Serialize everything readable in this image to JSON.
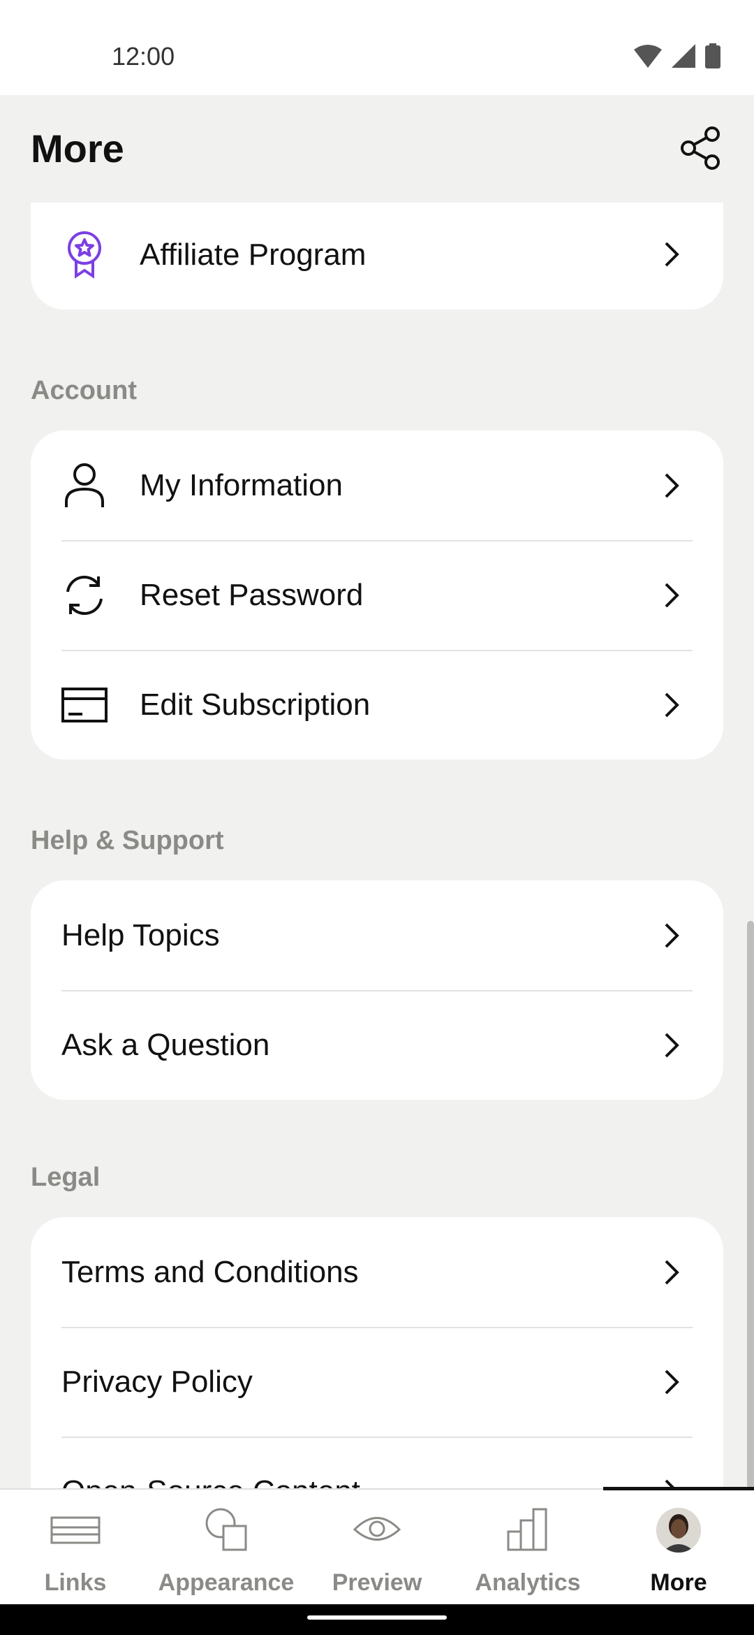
{
  "status": {
    "time": "12:00"
  },
  "header": {
    "title": "More"
  },
  "sections": {
    "top": {
      "items": [
        {
          "label": "Affiliate Program"
        }
      ]
    },
    "account": {
      "title": "Account",
      "items": [
        {
          "label": "My Information"
        },
        {
          "label": "Reset Password"
        },
        {
          "label": "Edit Subscription"
        }
      ]
    },
    "help": {
      "title": "Help & Support",
      "items": [
        {
          "label": "Help Topics"
        },
        {
          "label": "Ask a Question"
        }
      ]
    },
    "legal": {
      "title": "Legal",
      "items": [
        {
          "label": "Terms and Conditions"
        },
        {
          "label": "Privacy Policy"
        },
        {
          "label": "Open-Source Content"
        }
      ]
    }
  },
  "tabs": [
    {
      "label": "Links"
    },
    {
      "label": "Appearance"
    },
    {
      "label": "Preview"
    },
    {
      "label": "Analytics"
    },
    {
      "label": "More"
    }
  ],
  "active_tab": "More",
  "colors": {
    "accent": "#7b3fe4",
    "background": "#f1f1f0",
    "card": "#ffffff"
  }
}
